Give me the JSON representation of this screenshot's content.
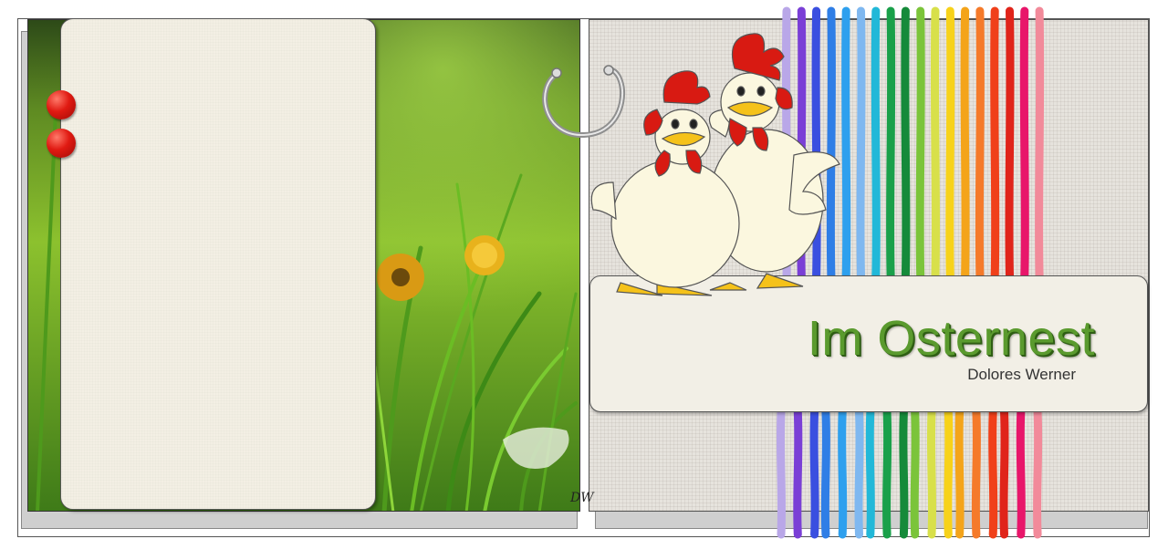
{
  "book": {
    "title": "Im Osternest",
    "author": "Dolores Werner",
    "signature": "DW"
  },
  "colors": {
    "title_green": "#5a9a2e",
    "ribbons": [
      "#b9a7e8",
      "#7a3fd6",
      "#3a4fe0",
      "#2f7ee6",
      "#2ea0ee",
      "#7fb8f0",
      "#22b8d8",
      "#1aa04a",
      "#158a3a",
      "#7bc43a",
      "#d8e04a",
      "#f7d21a",
      "#f4a41a",
      "#f57a2a",
      "#f0401a",
      "#e0241a",
      "#e8166a",
      "#f28a9a"
    ]
  },
  "icons": [
    "push-pin-icon",
    "ring-binder-icon",
    "chickens-illustration"
  ]
}
